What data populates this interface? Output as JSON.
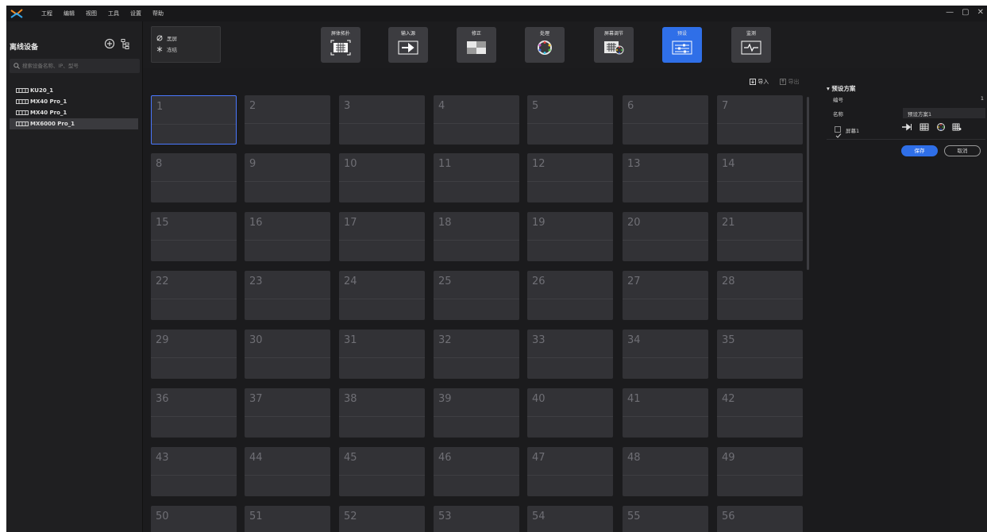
{
  "menu": [
    "工程",
    "编辑",
    "视图",
    "工具",
    "设置",
    "帮助"
  ],
  "window_controls": [
    "—",
    "▢",
    "✕"
  ],
  "sidebar": {
    "title": "离线设备",
    "search_placeholder": "搜索设备名称、IP、型号",
    "devices": [
      "KU20_1",
      "MX40 Pro_1",
      "MX40 Pro_1",
      "MX6000 Pro_1"
    ],
    "selected_device_index": 3
  },
  "quick_panel": {
    "blackout": "黑屏",
    "freeze": "冻结"
  },
  "toolbar": [
    {
      "label": "屏体拓扑",
      "icon": "topology-icon"
    },
    {
      "label": "输入源",
      "icon": "input-source-icon"
    },
    {
      "label": "修正",
      "icon": "correction-icon"
    },
    {
      "label": "处理",
      "icon": "processing-icon"
    },
    {
      "label": "屏幕调节",
      "icon": "screen-adjust-icon"
    },
    {
      "label": "预设",
      "icon": "preset-icon",
      "active": true
    },
    {
      "label": "监测",
      "icon": "monitor-icon"
    }
  ],
  "grid_actions": {
    "import": "导入",
    "export": "导出"
  },
  "presets": [
    "1",
    "2",
    "3",
    "4",
    "5",
    "6",
    "7",
    "8",
    "9",
    "10",
    "11",
    "12",
    "13",
    "14",
    "15",
    "16",
    "17",
    "18",
    "19",
    "20",
    "21",
    "22",
    "23",
    "24",
    "25",
    "26",
    "27",
    "28",
    "29",
    "30",
    "31",
    "32",
    "33",
    "34",
    "35",
    "36",
    "37",
    "38",
    "39",
    "40",
    "41",
    "42",
    "43",
    "44",
    "45",
    "46",
    "47",
    "48",
    "49",
    "50",
    "51",
    "52",
    "53",
    "54",
    "55",
    "56"
  ],
  "selected_preset": "1",
  "right_panel": {
    "title": "预设方案",
    "id_label": "编号",
    "id_value": "1",
    "name_label": "名称",
    "name_value": "预设方案1",
    "screen_label": "屏幕1",
    "screen_checked": true,
    "save": "保存",
    "cancel": "取消"
  },
  "colors": {
    "accent": "#2f6fe8",
    "background": "#1c1c1e",
    "cell": "#323236"
  }
}
